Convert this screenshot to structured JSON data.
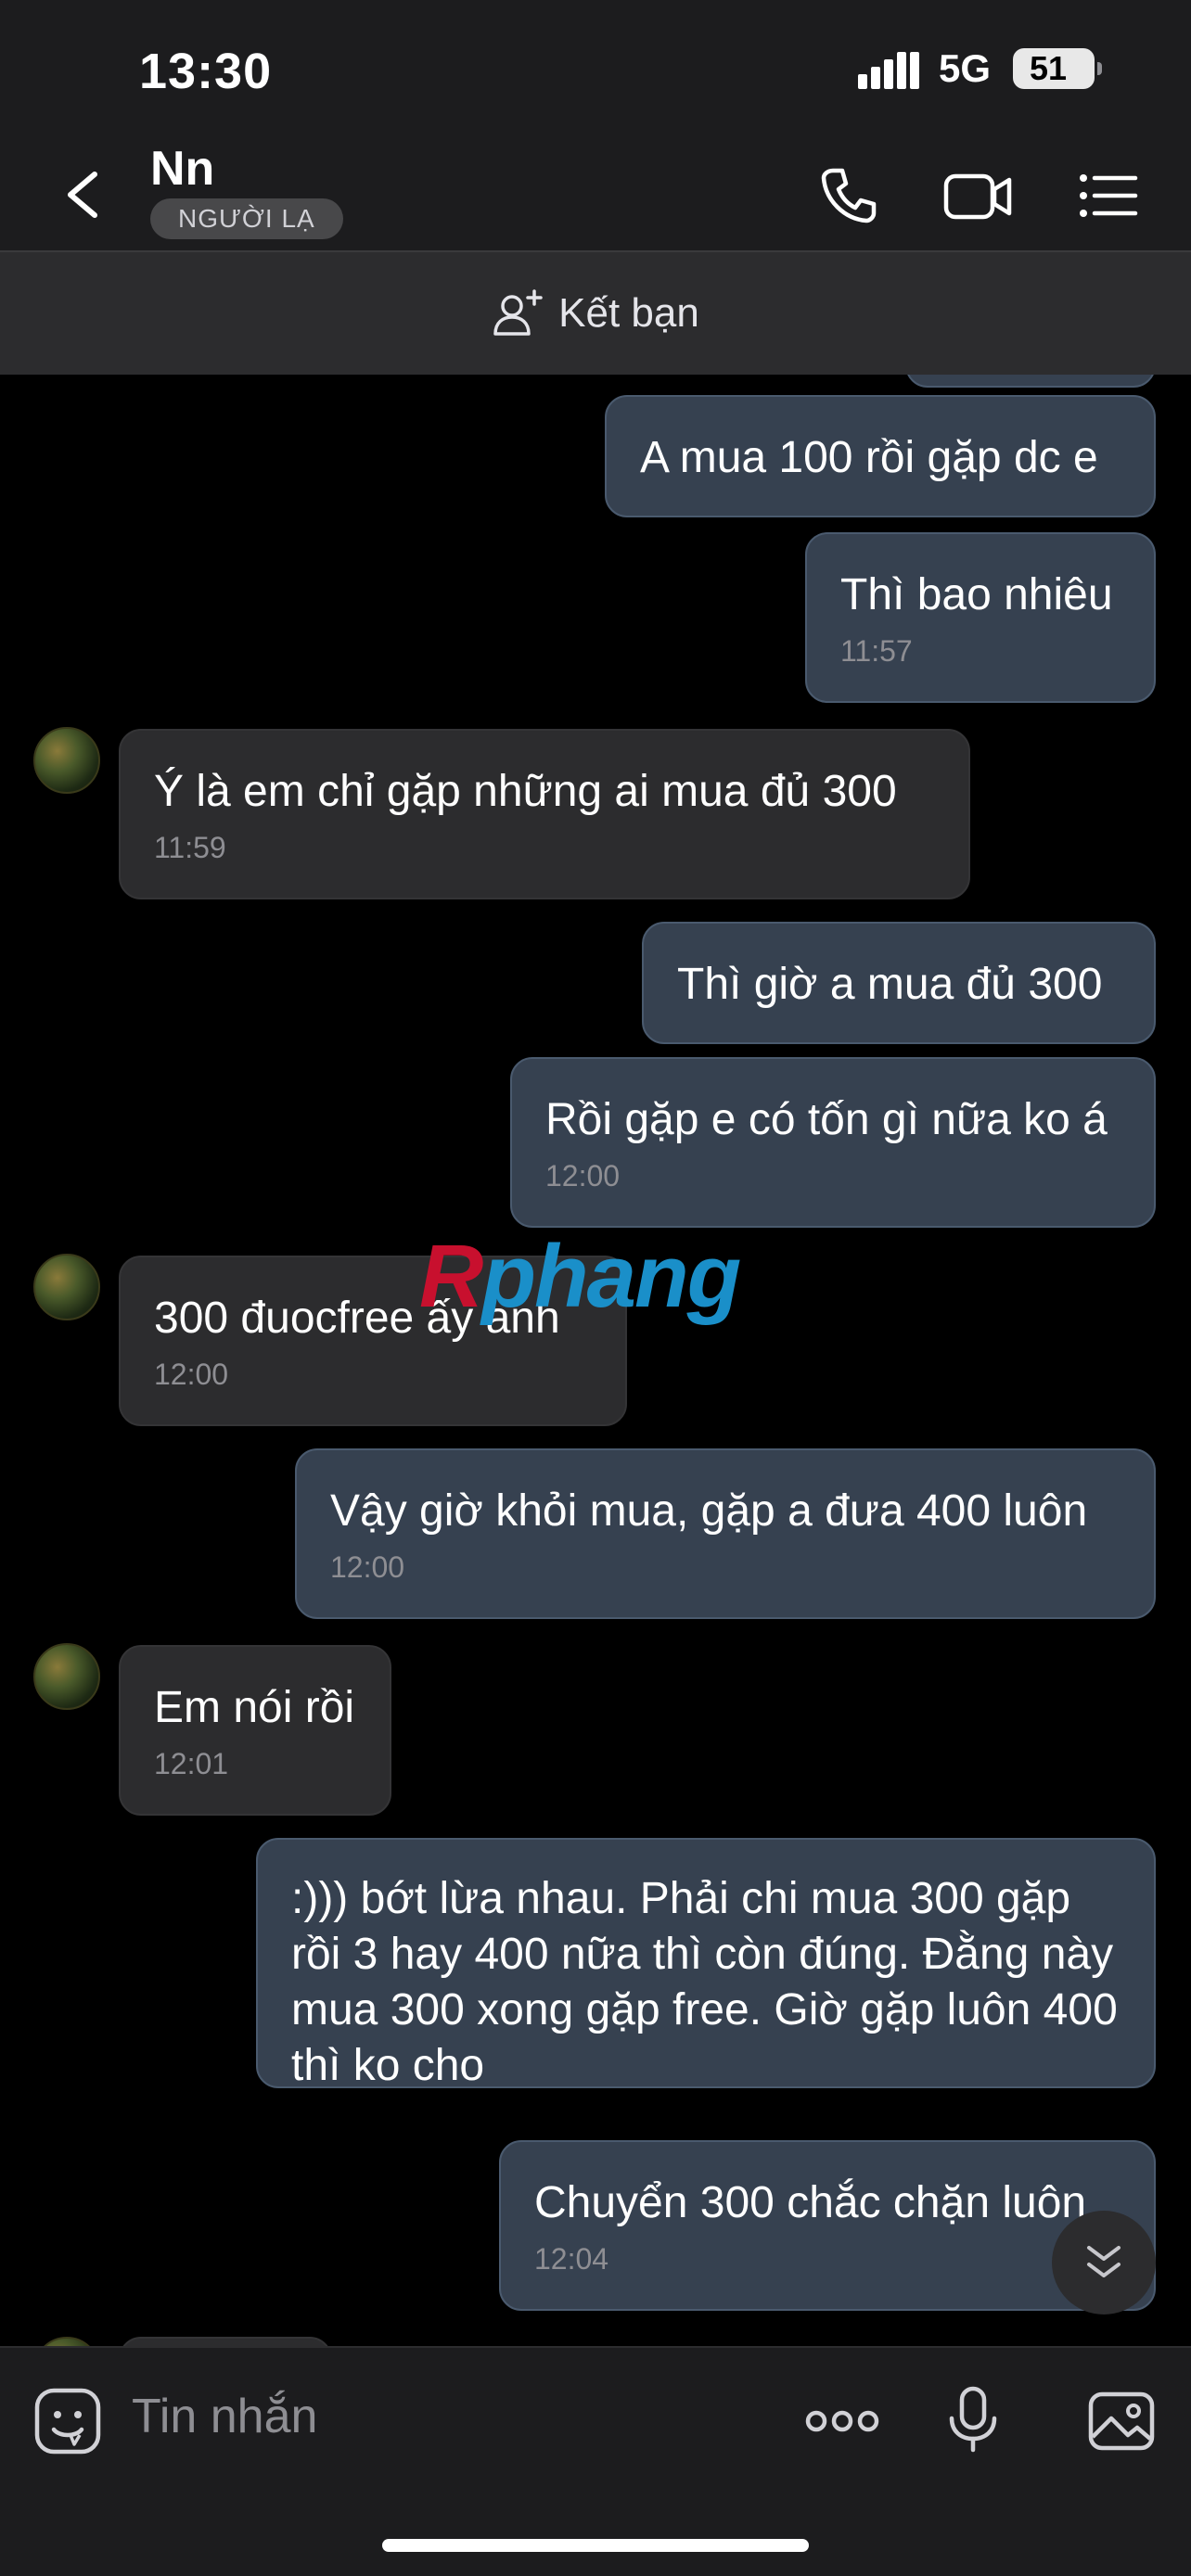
{
  "status_bar": {
    "time": "13:30",
    "network": "5G",
    "battery": "51"
  },
  "header": {
    "contact_name": "Nn",
    "badge": "NGƯỜI LẠ"
  },
  "friend_bar": {
    "label": "Kết bạn"
  },
  "messages": [
    {
      "text": "A mua 100 rồi gặp dc e",
      "time": ""
    },
    {
      "text": "Thì bao nhiêu",
      "time": "11:57"
    },
    {
      "text": "Ý là em chỉ gặp những ai mua đủ 300",
      "time": "11:59"
    },
    {
      "text": "Thì giờ a mua đủ 300",
      "time": ""
    },
    {
      "text": "Rồi gặp e có tốn gì nữa ko á",
      "time": "12:00"
    },
    {
      "text": "300 đuocfree ấy anh",
      "time": "12:00"
    },
    {
      "text": "Vậy giờ khỏi mua, gặp a đưa 400 luôn",
      "time": "12:00"
    },
    {
      "text": "Em nói rồi",
      "time": "12:01"
    },
    {
      "text": ":))) bớt lừa nhau. Phải chi mua 300 gặp rồi 3 hay 400 nữa thì còn đúng. Đằng này mua 300 xong gặp free. Giờ gặp luôn 400 thì ko cho",
      "time": ""
    },
    {
      "text": "Chuyển 300 chắc chặn luôn",
      "time": "12:04"
    }
  ],
  "watermark": {
    "part1": "R",
    "part2": "phang"
  },
  "input": {
    "placeholder": "Tin nhắn"
  }
}
